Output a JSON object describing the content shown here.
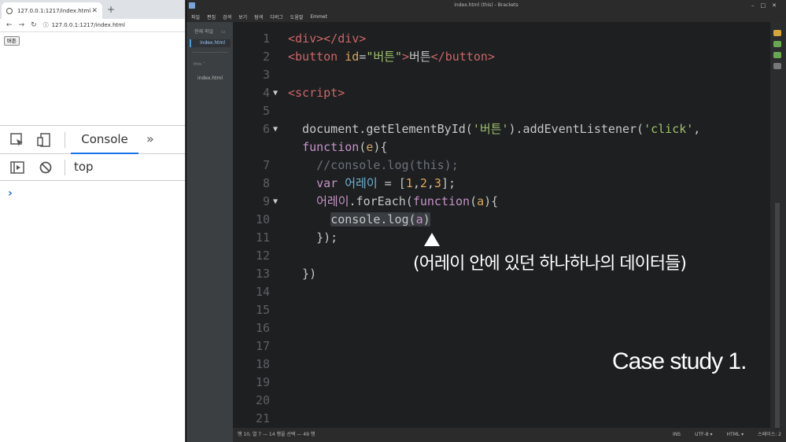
{
  "browser": {
    "tab_title": "127.0.0.1:1217/index.html",
    "tab_close": "✕",
    "new_tab": "+",
    "url": "127.0.0.1:1217/index.html",
    "page_button_label": "버튼",
    "devtools": {
      "console_tab": "Console",
      "more": "»",
      "context": "top",
      "prompt": "›"
    }
  },
  "editor": {
    "window_title": "index.html (this) - Brackets",
    "menu": [
      "파일",
      "편집",
      "검색",
      "보기",
      "탐색",
      "디버그",
      "도움말",
      "Emmet"
    ],
    "sidebar": {
      "working_files_label": "현재 파일",
      "open_file": "index.html",
      "project_label": "this ˅",
      "project_file": "index.html"
    },
    "line_numbers": [
      "1",
      "2",
      "3",
      "4",
      "5",
      "6",
      "",
      "7",
      "8",
      "9",
      "10",
      "11",
      "12",
      "13",
      "14",
      "15",
      "16",
      "17",
      "18",
      "19",
      "20",
      "21"
    ],
    "status": {
      "position": "행 10, 열 7 — 14 행을 선택 — 49 행",
      "ins": "INS",
      "encoding": "UTF-8 ▾",
      "language": "HTML ▾",
      "spaces": "스페이스: 2"
    }
  },
  "annotations": {
    "note": "(어레이 안에 있던 하나하나의 데이터들)",
    "case": "Case study 1."
  },
  "colors": {
    "editor_bg": "#1d1f21",
    "tag": "#cc6666",
    "string": "#9ec16d",
    "keyword": "#c693c6",
    "number": "#e8a656",
    "accent_blue": "#1a73e8"
  }
}
